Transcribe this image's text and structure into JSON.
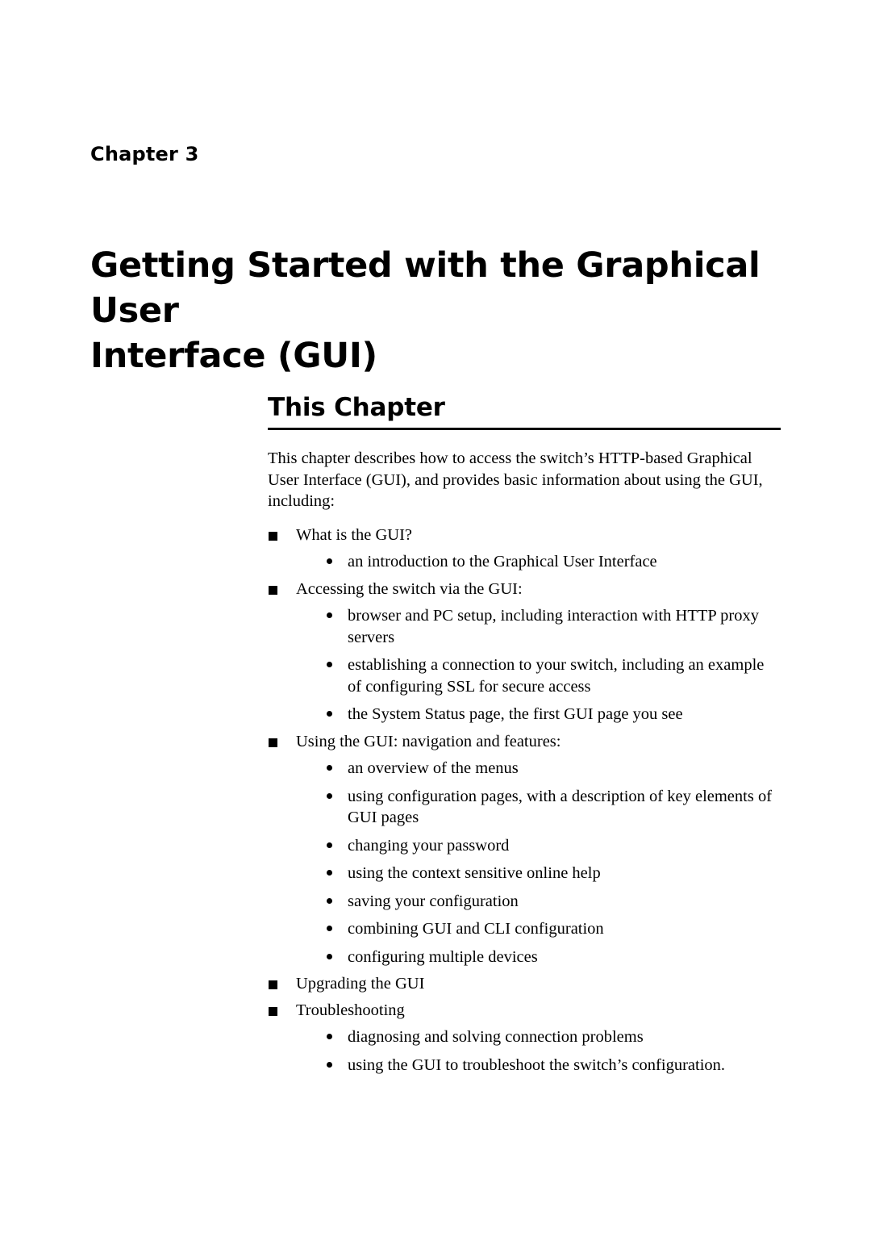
{
  "page": {
    "background_color": "#ffffff",
    "text_color": "#000000"
  },
  "chapter": {
    "label": "Chapter 3",
    "title_line1": "Getting Started with the Graphical User",
    "title_line2": "Interface (GUI)"
  },
  "section": {
    "heading": "This Chapter",
    "rule_color": "#000000",
    "intro": "This chapter describes how to access the switch’s HTTP-based Graphical User Interface (GUI), and provides basic information about using the GUI, including:",
    "bullets": [
      {
        "text": "What is the GUI?",
        "children": [
          "an introduction to the Graphical User Interface"
        ]
      },
      {
        "text": "Accessing the switch via the GUI:",
        "children": [
          "browser and PC setup, including interaction with HTTP proxy servers",
          "establishing a connection to your switch, including an example of configuring SSL for secure access",
          "the System Status page, the first GUI page you see"
        ]
      },
      {
        "text": "Using the GUI: navigation and features:",
        "children": [
          "an overview of the menus",
          "using configuration pages, with a description of key elements of GUI pages",
          "changing your password",
          "using the context sensitive online help",
          "saving your configuration",
          "combining GUI and CLI configuration",
          "configuring multiple devices"
        ]
      },
      {
        "text": "Upgrading the GUI",
        "children": []
      },
      {
        "text": "Troubleshooting",
        "children": [
          "diagnosing and solving connection problems",
          "using the GUI to troubleshoot the switch’s configuration."
        ]
      }
    ]
  }
}
